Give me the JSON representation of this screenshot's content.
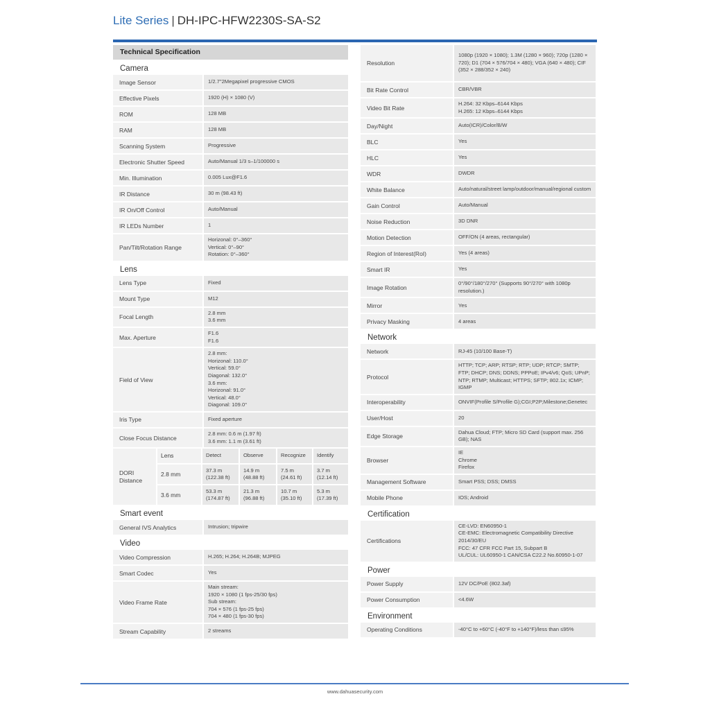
{
  "header": {
    "series": "Lite Series",
    "separator": "|",
    "model": "DH-IPC-HFW2230S-SA-S2",
    "accent_color": "#2b66b1"
  },
  "left": {
    "ts_header": "Technical Specification",
    "camera": {
      "title": "Camera",
      "rows": [
        {
          "k": "Image Sensor",
          "v": [
            "1/2.7\"2Megapixel progressive CMOS"
          ]
        },
        {
          "k": "Effective Pixels",
          "v": [
            "1920 (H) × 1080 (V)"
          ]
        },
        {
          "k": "ROM",
          "v": [
            "128 MB"
          ]
        },
        {
          "k": "RAM",
          "v": [
            "128 MB"
          ]
        },
        {
          "k": "Scanning System",
          "v": [
            "Progressive"
          ]
        },
        {
          "k": "Electronic Shutter Speed",
          "v": [
            "Auto/Manual 1/3 s–1/100000 s"
          ]
        },
        {
          "k": "Min. Illumination",
          "v": [
            "0.005 Lux@F1.6"
          ]
        },
        {
          "k": "IR Distance",
          "v": [
            "30 m (98.43 ft)"
          ]
        },
        {
          "k": "IR On/Off Control",
          "v": [
            "Auto/Manual"
          ]
        },
        {
          "k": "IR LEDs Number",
          "v": [
            "1"
          ]
        },
        {
          "k": "Pan/Tilt/Rotation Range",
          "v": [
            "Horizonal: 0°–360°",
            "Vertical: 0°–90°",
            "Rotation: 0°–360°"
          ]
        }
      ]
    },
    "lens": {
      "title": "Lens",
      "rows": [
        {
          "k": "Lens Type",
          "v": [
            "Fixed"
          ]
        },
        {
          "k": "Mount Type",
          "v": [
            "M12"
          ]
        },
        {
          "k": "Focal Length",
          "v": [
            "2.8 mm",
            "3.6 mm"
          ]
        },
        {
          "k": "Max. Aperture",
          "v": [
            "F1.6",
            "F1.6"
          ]
        },
        {
          "k": "Field of View",
          "v": [
            "2.8 mm:",
            "Horizonal: 110.0°",
            "Vertical: 59.0°",
            "Diagonal: 132.0°",
            "3.6 mm:",
            "Horizonal: 91.0°",
            "Vertical: 48.0°",
            "Diagonal: 109.0°"
          ]
        },
        {
          "k": "Iris Type",
          "v": [
            "Fixed aperture"
          ]
        },
        {
          "k": "Close Focus Distance",
          "v": [
            "2.8 mm: 0.6 m (1.97 ft)",
            "3.6 mm: 1.1 m (3.61 ft)"
          ]
        }
      ],
      "dori": {
        "label": "DORI Distance",
        "headers": [
          "Lens",
          "Detect",
          "Observe",
          "Recognize",
          "Identify"
        ],
        "rows": [
          [
            "2.8 mm",
            "37.3 m (122.38 ft)",
            "14.9 m (48.88 ft)",
            "7.5 m (24.61 ft)",
            "3.7 m (12.14 ft)"
          ],
          [
            "3.6 mm",
            "53.3 m (174.87 ft)",
            "21.3 m (96.88 ft)",
            "10.7 m (35.10 ft)",
            "5.3 m (17.39 ft)"
          ]
        ]
      }
    },
    "smart_event": {
      "title": "Smart event",
      "rows": [
        {
          "k": "General IVS Analytics",
          "v": [
            "Intrusion; tripwire"
          ]
        }
      ]
    },
    "video": {
      "title": "Video",
      "rows": [
        {
          "k": "Video Compression",
          "v": [
            "H.265; H.264; H.264B; MJPEG"
          ]
        },
        {
          "k": "Smart Codec",
          "v": [
            "Yes"
          ]
        },
        {
          "k": "Video Frame Rate",
          "v": [
            "Main stream:",
            "1920 × 1080 (1 fps-25/30 fps)",
            "Sub stream:",
            "704 × 576 (1 fps-25 fps)",
            "704 × 480 (1 fps-30 fps)"
          ]
        },
        {
          "k": "Stream Capability",
          "v": [
            "2 streams"
          ]
        }
      ]
    }
  },
  "right": {
    "video_cont": {
      "rows": [
        {
          "k": "Resolution",
          "v": [
            "1080p (1920 × 1080); 1.3M (1280 × 960); 720p (1280 × 720); D1 (704 × 576/704 × 480); VGA (640 × 480); CIF (352 × 288/352 × 240)"
          ]
        },
        {
          "k": "Bit Rate Control",
          "v": [
            "CBR/VBR"
          ]
        },
        {
          "k": "Video Bit Rate",
          "v": [
            "H.264: 32 Kbps–6144 Kbps",
            "H.265: 12 Kbps–6144 Kbps"
          ]
        },
        {
          "k": "Day/Night",
          "v": [
            "Auto(ICR)/Color/B/W"
          ]
        },
        {
          "k": "BLC",
          "v": [
            "Yes"
          ]
        },
        {
          "k": "HLC",
          "v": [
            "Yes"
          ]
        },
        {
          "k": "WDR",
          "v": [
            "DWDR"
          ]
        },
        {
          "k": "White Balance",
          "v": [
            "Auto/natural/street lamp/outdoor/manual/regional custom"
          ]
        },
        {
          "k": "Gain Control",
          "v": [
            "Auto/Manual"
          ]
        },
        {
          "k": "Noise Reduction",
          "v": [
            "3D DNR"
          ]
        },
        {
          "k": "Motion Detection",
          "v": [
            "OFF/ON (4 areas, rectangular)"
          ]
        },
        {
          "k": "Region of Interest(RoI)",
          "v": [
            "Yes (4 areas)"
          ]
        },
        {
          "k": "Smart IR",
          "v": [
            "Yes"
          ]
        },
        {
          "k": "Image Rotation",
          "v": [
            "0°/90°/180°/270° (Supports 90°/270° with 1080p resolution.)"
          ]
        },
        {
          "k": "Mirror",
          "v": [
            "Yes"
          ]
        },
        {
          "k": "Privacy Masking",
          "v": [
            "4 areas"
          ]
        }
      ]
    },
    "network": {
      "title": "Network",
      "rows": [
        {
          "k": "Network",
          "v": [
            "RJ-45 (10/100 Base-T)"
          ]
        },
        {
          "k": "Protocol",
          "v": [
            "HTTP; TCP; ARP; RTSP; RTP; UDP; RTCP; SMTP; FTP; DHCP; DNS; DDNS; PPPoE; IPv4/v6; QoS; UPnP; NTP; RTMP; Multicast; HTTPS; SFTP; 802.1x; ICMP; IGMP"
          ]
        },
        {
          "k": "Interoperability",
          "v": [
            "ONVIF(Profile S/Profile G);CGI;P2P;Milestone;Genetec"
          ]
        },
        {
          "k": "User/Host",
          "v": [
            "20"
          ]
        },
        {
          "k": "Edge Storage",
          "v": [
            "Dahua Cloud; FTP; Micro SD Card (support max. 256 GB); NAS"
          ]
        },
        {
          "k": "Browser",
          "v": [
            "IE",
            "Chrome",
            "Firefox"
          ]
        },
        {
          "k": "Management Software",
          "v": [
            "Smart PSS; DSS; DMSS"
          ]
        },
        {
          "k": "Mobile Phone",
          "v": [
            "IOS; Android"
          ]
        }
      ]
    },
    "certification": {
      "title": "Certification",
      "rows": [
        {
          "k": "Certifications",
          "v": [
            "CE-LVD: EN60950-1",
            "CE-EMC: Electromagnetic Compatibility Directive 2014/30/EU",
            "FCC: 47 CFR FCC Part 15, Subpart B",
            "UL/CUL: UL60950-1 CAN/CSA C22.2 No.60950-1-07"
          ]
        }
      ]
    },
    "power": {
      "title": "Power",
      "rows": [
        {
          "k": "Power Supply",
          "v": [
            "12V DC/PoE (802.3af)"
          ]
        },
        {
          "k": "Power Consumption",
          "v": [
            "<4.6W"
          ]
        }
      ]
    },
    "environment": {
      "title": "Environment",
      "rows": [
        {
          "k": "Operating Conditions",
          "v": [
            "-40°C to +60°C (-40°F to +140°F)/less than ≤95%"
          ]
        }
      ]
    }
  },
  "footer": {
    "url": "www.dahuasecurity.com"
  }
}
